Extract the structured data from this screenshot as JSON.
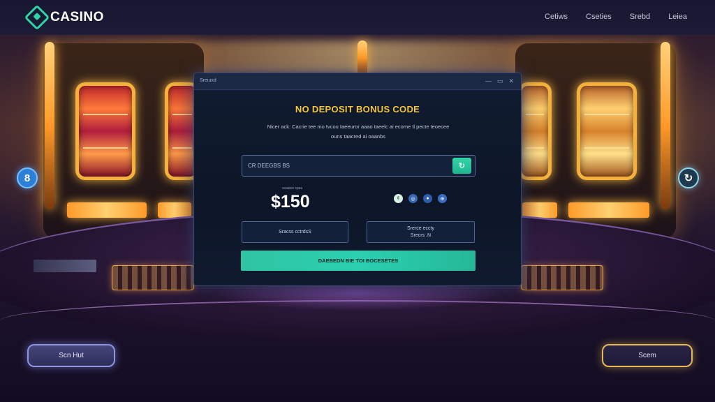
{
  "header": {
    "logo_text": "CASINO",
    "nav": [
      "Cetiws",
      "Cseties",
      "Srebd",
      "Leiea"
    ]
  },
  "side_buttons": {
    "left_symbol": "8",
    "right_symbol": "↻"
  },
  "modal": {
    "bar_title": "Sreiuxd",
    "window_controls": [
      "—",
      "▭",
      "✕"
    ],
    "title": "NO DEPOSIT BONUS CODE",
    "description_line1": "Nicer ack: Cacrie tee mo tvcou  Iaeeuror aaao taeelc ai ecome tl pecte teoecee",
    "description_line2": "ouns taacred ai oaanbs",
    "code_placeholder": "CR DEEGBS BS",
    "apply_symbol": "↻",
    "amount_label": "sxaaiso spaa",
    "amount": "$150",
    "dots": [
      "¢",
      "◎",
      "●",
      "⊕"
    ],
    "option_left": "Sracss cctrdsS",
    "option_right_line1": "Srerce eccty",
    "option_right_line2": "Srecrs .N",
    "claim_label": "DAEBEDN BIE TOI BOCESETES"
  },
  "footer": {
    "left_button": "Scn Hut",
    "right_button": "Scem"
  },
  "colors": {
    "accent_teal": "#2fd3a6",
    "title_gold": "#f5c53a",
    "modal_bg": "#0d1628"
  }
}
